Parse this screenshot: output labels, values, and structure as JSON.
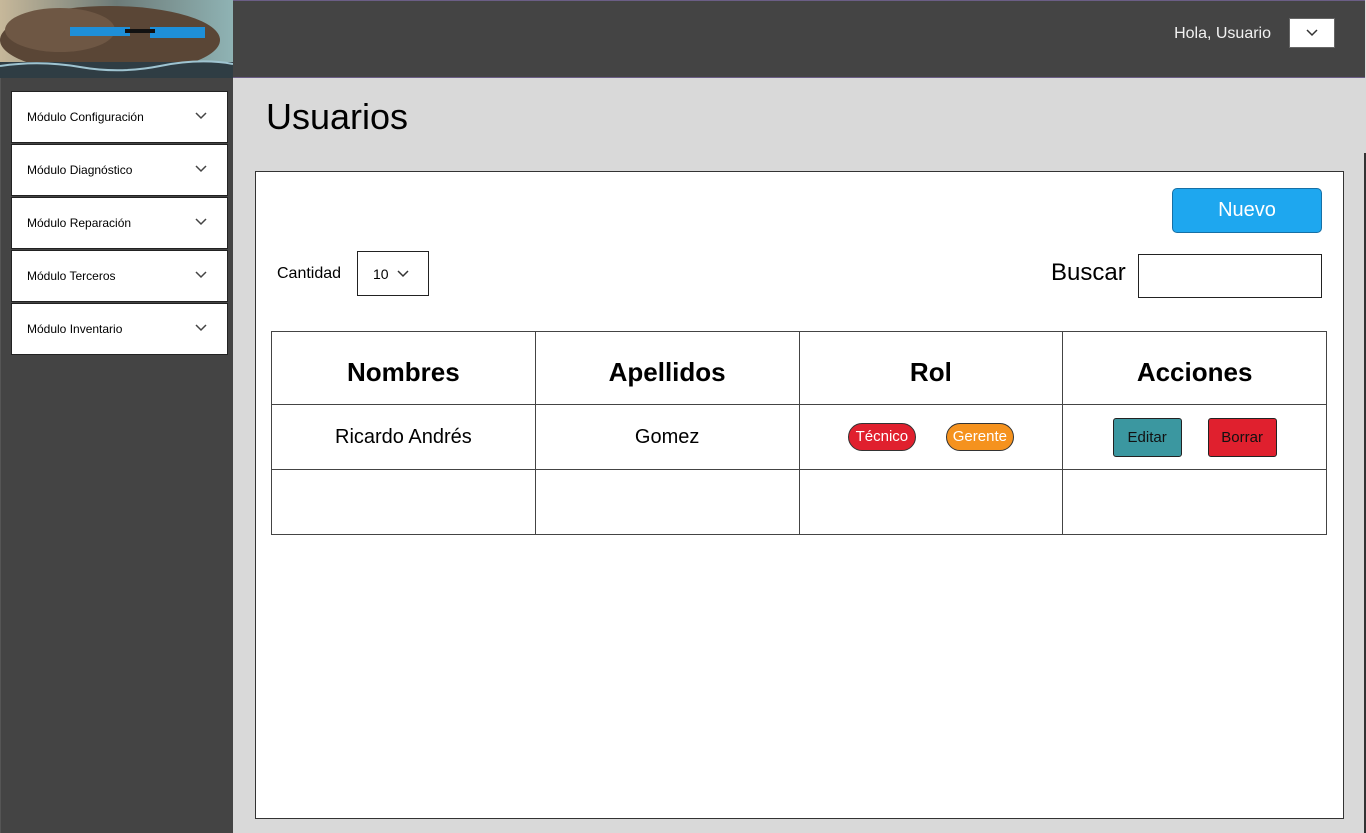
{
  "header": {
    "greeting": "Hola, Usuario",
    "user_menu_icon": "chevron-down-icon"
  },
  "sidebar": {
    "items": [
      {
        "label": "Módulo Configuración",
        "icon": "chevron-down-icon"
      },
      {
        "label": "Módulo Diagnóstico",
        "icon": "chevron-down-icon"
      },
      {
        "label": "Módulo Reparación",
        "icon": "chevron-down-icon"
      },
      {
        "label": "Módulo Terceros",
        "icon": "chevron-down-icon"
      },
      {
        "label": "Módulo Inventario",
        "icon": "chevron-down-icon"
      }
    ]
  },
  "main": {
    "title": "Usuarios",
    "new_button": "Nuevo",
    "quantity_label": "Cantidad",
    "quantity_value": "10",
    "search_label": "Buscar",
    "search_value": ""
  },
  "table": {
    "headers": [
      "Nombres",
      "Apellidos",
      "Rol",
      "Acciones"
    ],
    "rows": [
      {
        "nombres": "Ricardo Andrés",
        "apellidos": "Gomez",
        "roles": [
          {
            "label": "Técnico",
            "color": "#e0202e"
          },
          {
            "label": "Gerente",
            "color": "#f5921e"
          }
        ],
        "actions": [
          {
            "label": "Editar",
            "color": "#3b97a0"
          },
          {
            "label": "Borrar",
            "color": "#e0202e"
          }
        ]
      }
    ]
  },
  "colors": {
    "topbar": "#444444",
    "sidebar": "#444444",
    "content_bg": "#d9d9d9",
    "accent": "#1ea7ef"
  }
}
